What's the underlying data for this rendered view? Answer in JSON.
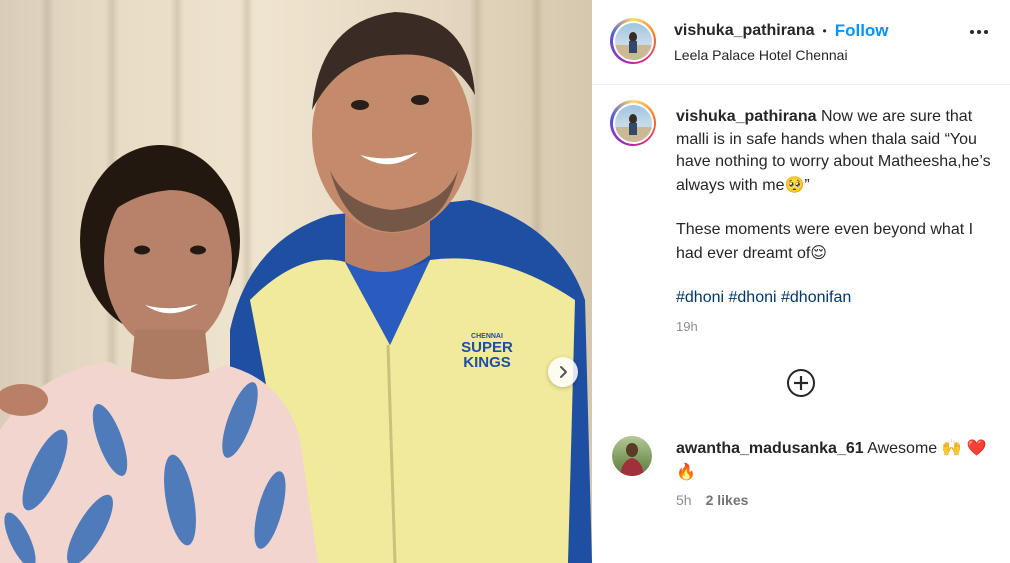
{
  "post": {
    "author": "vishuka_pathirana",
    "follow_label": "Follow",
    "separator": "•",
    "location": "Leela Palace Hotel Chennai"
  },
  "caption": {
    "author": "vishuka_pathirana",
    "line1": "Now we are sure that malli is in safe hands when thala said “You have nothing to worry about Matheesha,he’s always with me",
    "line1_emoji": "🥺",
    "line1_tail": "”",
    "line2": "These moments were even beyond what I had ever dreamt of",
    "line2_emoji": "😌",
    "hashtags": [
      "#dhoni",
      "#dhoni",
      "#dhonifan"
    ],
    "time": "19h"
  },
  "comments": [
    {
      "author": "awantha_madusanka_61",
      "text": "Awesome",
      "emojis": "🙌 ❤️ 🔥",
      "time": "5h",
      "likes": "2 likes"
    }
  ],
  "photo": {
    "jersey_logo_small": "CHENNAI",
    "jersey_logo_main": "SUPER",
    "jersey_logo_sub": "KINGS"
  },
  "icons": {
    "next": "chevron-right-icon",
    "more": "more-horizontal-icon",
    "add": "add-circle-icon"
  }
}
